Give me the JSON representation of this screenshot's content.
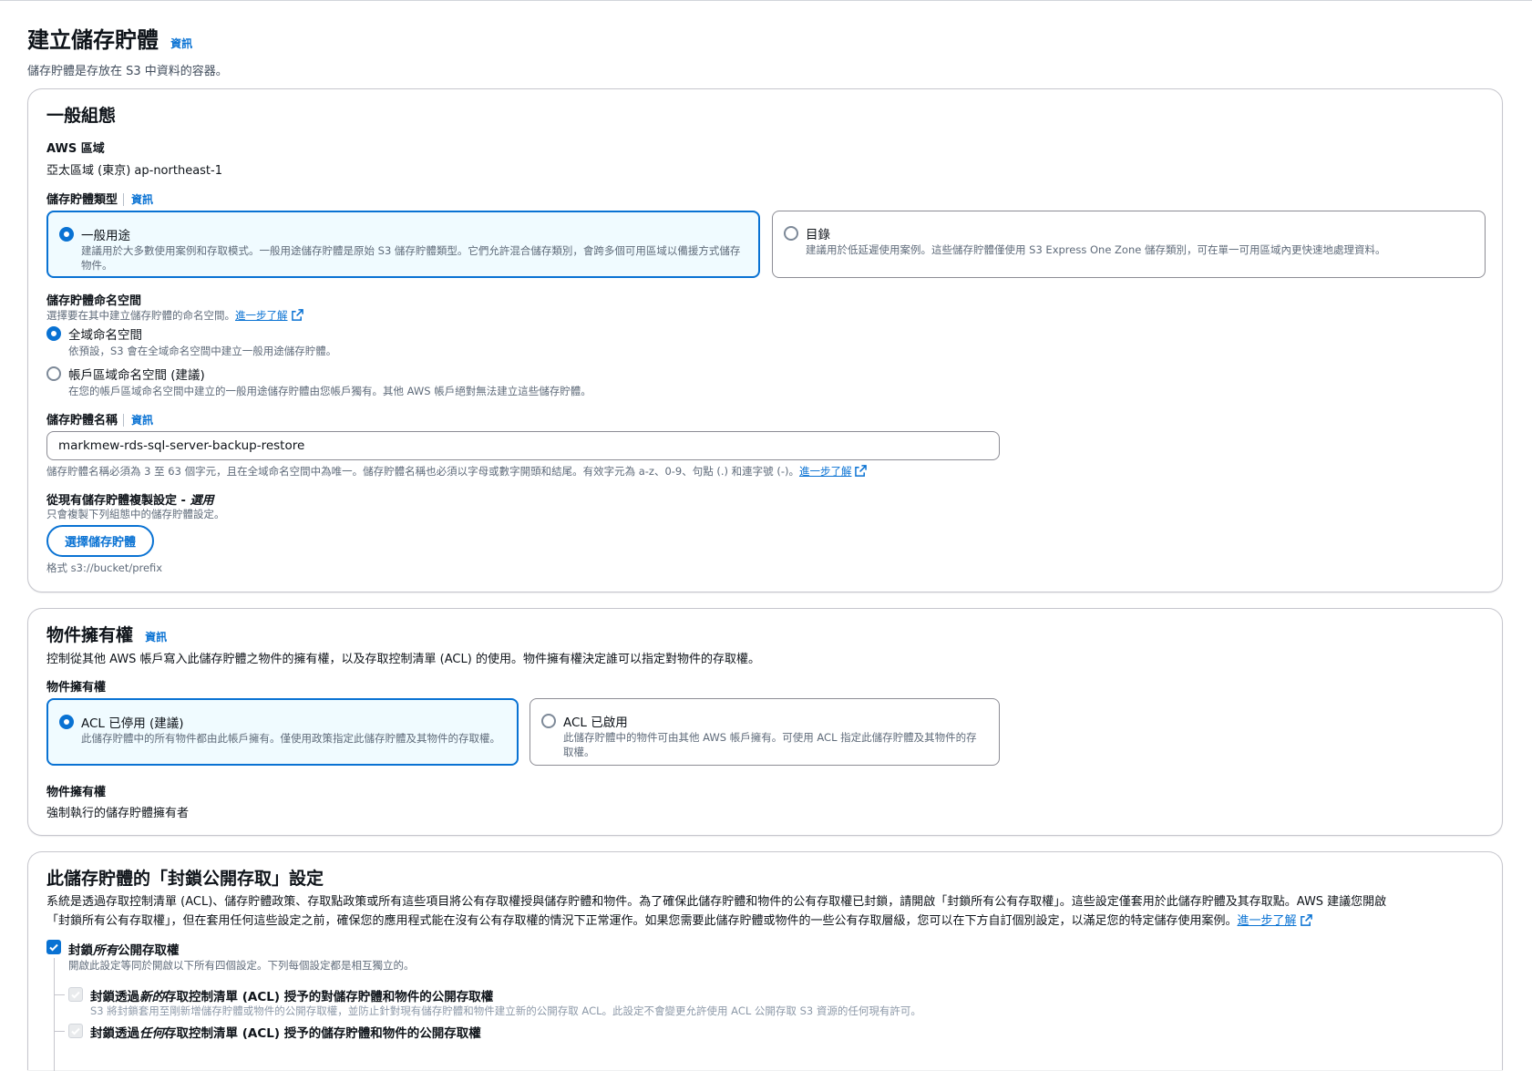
{
  "page": {
    "title": "建立儲存貯體",
    "info": "資訊",
    "description": "儲存貯體是存放在 S3 中資料的容器。"
  },
  "general": {
    "heading": "一般組態",
    "region_label": "AWS 區域",
    "region_value": "亞太區域 (東京) ap-northeast-1",
    "bucket_type_label": "儲存貯體類型",
    "info": "資訊",
    "types": [
      {
        "title": "一般用途",
        "desc": "建議用於大多數使用案例和存取模式。一般用途儲存貯體是原始 S3 儲存貯體類型。它們允許混合儲存類別，會跨多個可用區域以備援方式儲存物件。",
        "selected": true
      },
      {
        "title": "目錄",
        "desc": "建議用於低延遲使用案例。這些儲存貯體僅使用 S3 Express One Zone 儲存類別，可在單一可用區域內更快速地處理資料。",
        "selected": false
      }
    ],
    "namespace_label": "儲存貯體命名空間",
    "namespace_desc": "選擇要在其中建立儲存貯體的命名空間。",
    "learn_more": "進一步了解",
    "namespaces": [
      {
        "title": "全域命名空間",
        "desc": "依預設，S3 會在全域命名空間中建立一般用途儲存貯體。",
        "selected": true
      },
      {
        "title": "帳戶區域命名空間 (建議)",
        "desc": "在您的帳戶區域命名空間中建立的一般用途儲存貯體由您帳戶獨有。其他 AWS 帳戶絕對無法建立這些儲存貯體。",
        "selected": false
      }
    ],
    "name_label": "儲存貯體名稱",
    "name_value": "markmew-rds-sql-server-backup-restore",
    "name_hint": "儲存貯體名稱必須為 3 至 63 個字元，且在全域命名空間中為唯一。儲存貯體名稱也必須以字母或數字開頭和結尾。有效字元為 a-z、0-9、句點 (.) 和連字號 (-)。",
    "copy_label": "從現有儲存貯體複製設定 - ",
    "copy_optional": "選用",
    "copy_desc": "只會複製下列組態中的儲存貯體設定。",
    "choose_button": "選擇儲存貯體",
    "format_hint": "格式 s3://bucket/prefix"
  },
  "ownership": {
    "heading": "物件擁有權",
    "info": "資訊",
    "description": "控制從其他 AWS 帳戶寫入此儲存貯體之物件的擁有權，以及存取控制清單 (ACL) 的使用。物件擁有權決定誰可以指定對物件的存取權。",
    "label": "物件擁有權",
    "options": [
      {
        "title": "ACL 已停用 (建議)",
        "desc": "此儲存貯體中的所有物件都由此帳戶擁有。僅使用政策指定此儲存貯體及其物件的存取權。",
        "selected": true
      },
      {
        "title": "ACL 已啟用",
        "desc": "此儲存貯體中的物件可由其他 AWS 帳戶擁有。可使用 ACL 指定此儲存貯體及其物件的存取權。",
        "selected": false
      }
    ],
    "result_label": "物件擁有權",
    "result_value": "強制執行的儲存貯體擁有者"
  },
  "block_public": {
    "heading": "此儲存貯體的「封鎖公開存取」設定",
    "description": "系統是透過存取控制清單 (ACL)、儲存貯體政策、存取點政策或所有這些項目將公有存取權授與儲存貯體和物件。為了確保此儲存貯體和物件的公有存取權已封鎖，請開啟「封鎖所有公有存取權」。這些設定僅套用於此儲存貯體及其存取點。AWS 建議您開啟",
    "description2": "「封鎖所有公有存取權」，但在套用任何這些設定之前，確保您的應用程式能在沒有公有存取權的情況下正常運作。如果您需要此儲存貯體或物件的一些公有存取層級，您可以在下方自訂個別設定，以滿足您的特定儲存使用案例。",
    "learn_more": "進一步了解",
    "block_all_pre": "封鎖",
    "block_all_em": "所有",
    "block_all_post": "公開存取權",
    "block_all_desc": "開啟此設定等同於開啟以下所有四個設定。下列每個設定都是相互獨立的。",
    "sub1_pre": "封鎖透過",
    "sub1_em": "新的",
    "sub1_post": "存取控制清單 (ACL) 授予的對儲存貯體和物件的公開存取權",
    "sub1_desc": "S3 將封鎖套用至剛新增儲存貯體或物件的公開存取權，並防止針對現有儲存貯體和物件建立新的公開存取 ACL。此設定不會變更允許使用 ACL 公開存取 S3 資源的任何現有許可。",
    "sub2_pre": "封鎖透過",
    "sub2_em": "任何",
    "sub2_post": "存取控制清單 (ACL) 授予的儲存貯體和物件的公開存取權"
  }
}
